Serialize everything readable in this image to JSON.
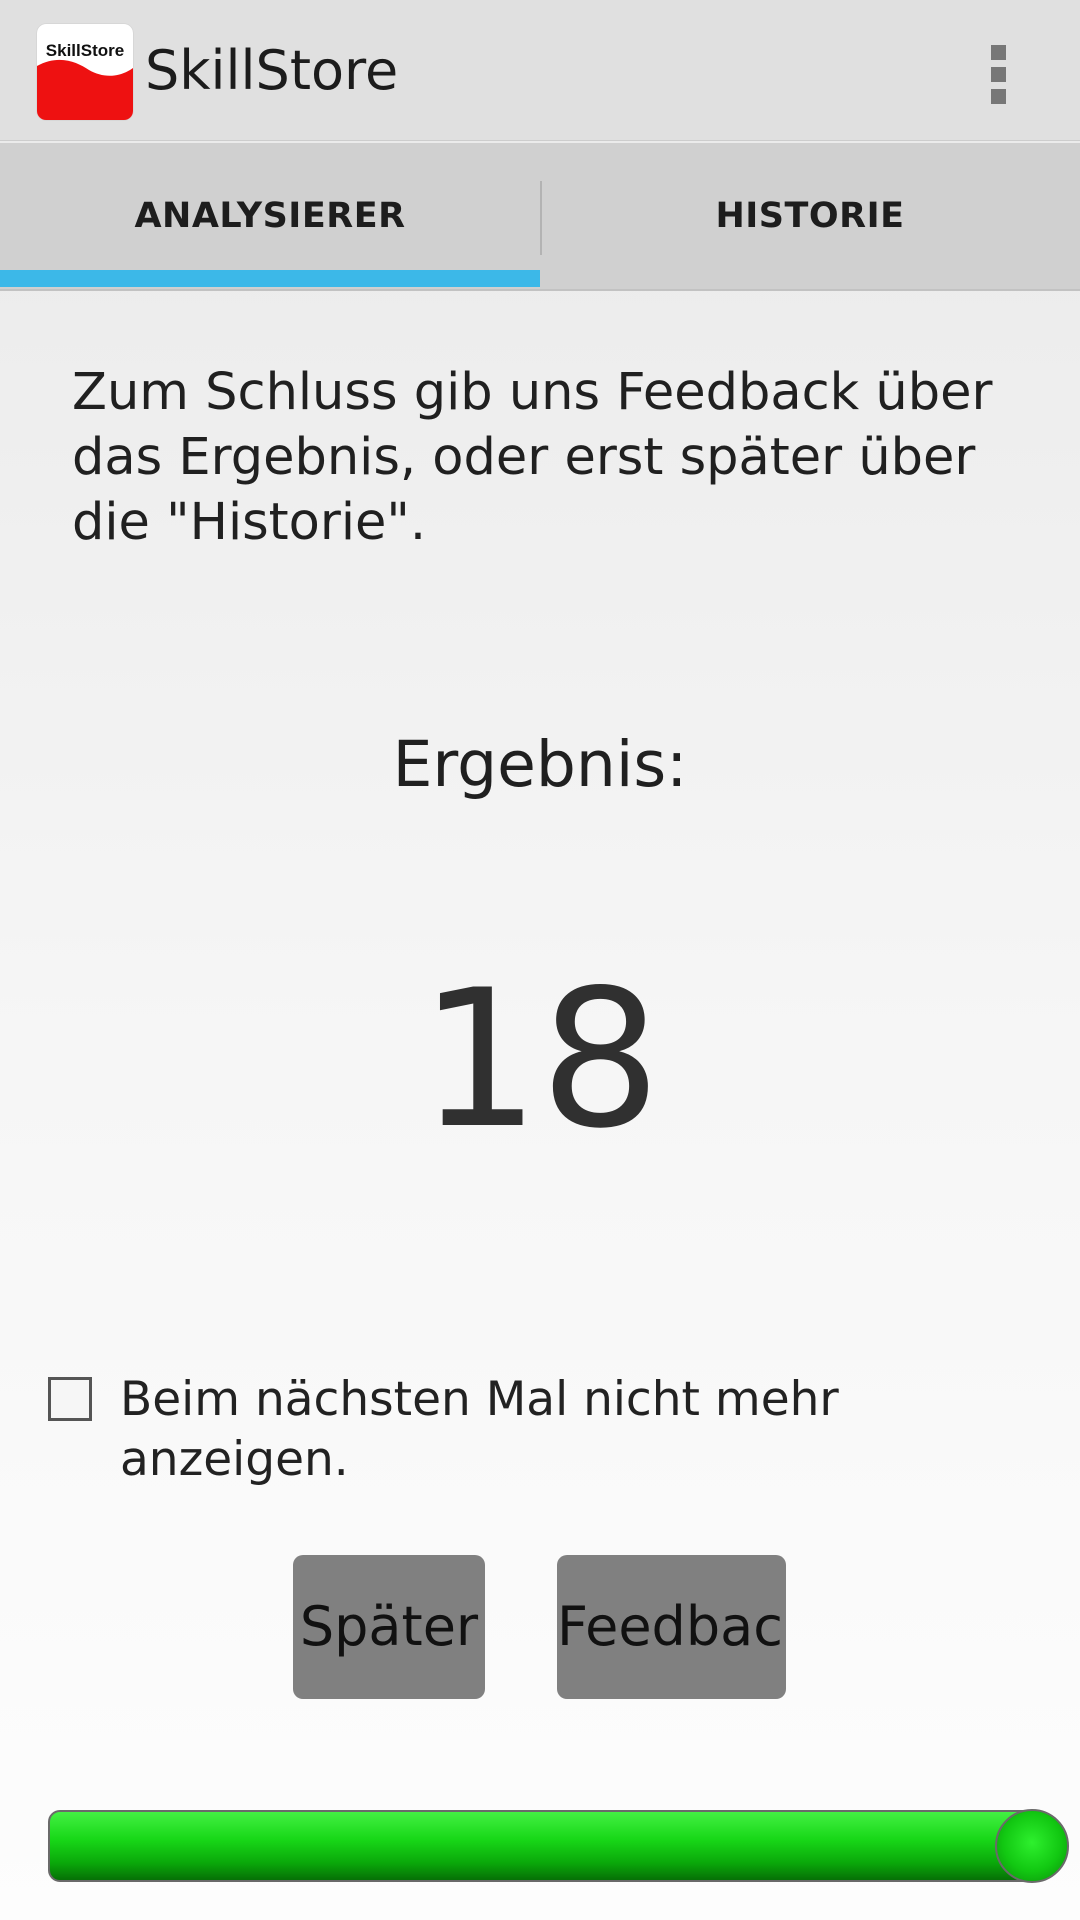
{
  "app": {
    "title": "SkillStore",
    "logo_text": "SkillStore",
    "logo_icon": "skillstore-logo-icon",
    "overflow_icon": "more-vertical-icon"
  },
  "tabs": [
    {
      "label": "ANALYSIERER",
      "selected": true
    },
    {
      "label": "HISTORIE",
      "selected": false
    }
  ],
  "content": {
    "intro": "Zum Schluss gib uns Feedback über das Ergebnis, oder erst später über die \"Historie\".",
    "result_label": "Ergebnis:",
    "result_value": "18",
    "checkbox_label": "Beim nächsten Mal nicht mehr anzeigen.",
    "checkbox_checked": false
  },
  "buttons": {
    "later": "Später",
    "feedback": "Feedback"
  },
  "slider": {
    "value_fraction": 1.0
  },
  "colors": {
    "tab_indicator": "#3cb8e8",
    "logo_red": "#ee1111",
    "button_bg": "#808080",
    "slider_green": "#18d818"
  }
}
